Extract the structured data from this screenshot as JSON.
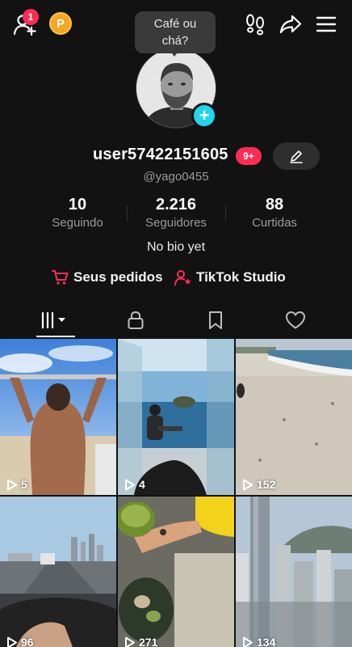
{
  "topbar": {
    "friends_badge": "1",
    "coin_letter": "P"
  },
  "bubble": {
    "line1": "Café ou",
    "line2": "chá?"
  },
  "profile": {
    "username": "user57422151605",
    "notifications": "9+",
    "handle": "@yago0455",
    "bio": "No bio yet"
  },
  "stats": [
    {
      "value": "10",
      "label": "Seguindo"
    },
    {
      "value": "2.216",
      "label": "Seguidores"
    },
    {
      "value": "88",
      "label": "Curtidas"
    }
  ],
  "links": {
    "orders": "Seus pedidos",
    "studio": "TikTok Studio"
  },
  "videos": [
    {
      "views": "5"
    },
    {
      "views": "4"
    },
    {
      "views": "152"
    },
    {
      "views": "96"
    },
    {
      "views": "271"
    },
    {
      "views": "134"
    }
  ],
  "colors": {
    "background": "#121212",
    "accent": "#fe2c55",
    "plus": "#20d5ec",
    "coin": "#f5a623"
  }
}
